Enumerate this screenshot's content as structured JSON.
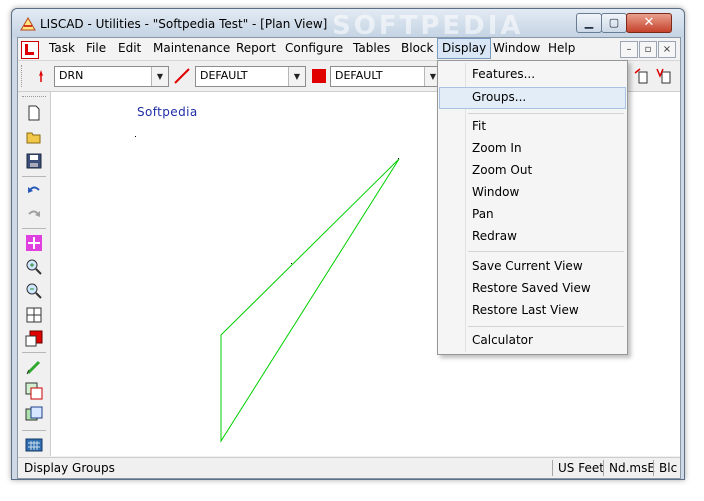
{
  "window": {
    "title": "LISCAD - Utilities - \"Softpedia Test\" - [Plan View]",
    "watermark": "SOFTPEDIA",
    "buttons": {
      "minimize": "▁",
      "maximize": "▢",
      "close": "✕"
    }
  },
  "menubar": {
    "items": [
      "Task",
      "File",
      "Edit",
      "Maintenance",
      "Report",
      "Configure",
      "Tables",
      "Block",
      "Display",
      "Window",
      "Help"
    ],
    "active": "Display",
    "mdi_buttons": [
      "–",
      "▫",
      "×"
    ]
  },
  "toolbar": {
    "layer_value": "DRN",
    "linetype_value": "DEFAULT",
    "color_value": "DEFAULT",
    "line_color": "#e00000",
    "fill_color": "#e00000"
  },
  "canvas": {
    "label": "Softpedia",
    "line_color": "#00d000"
  },
  "display_menu": {
    "items": [
      {
        "label": "Features...",
        "highlighted": false
      },
      {
        "label": "Groups...",
        "highlighted": true
      },
      {
        "label": "Fit",
        "highlighted": false
      },
      {
        "label": "Zoom In",
        "highlighted": false
      },
      {
        "label": "Zoom Out",
        "highlighted": false
      },
      {
        "label": "Window",
        "highlighted": false
      },
      {
        "label": "Pan",
        "highlighted": false
      },
      {
        "label": "Redraw",
        "highlighted": false
      },
      {
        "label": "Save Current View",
        "highlighted": false
      },
      {
        "label": "Restore Saved View",
        "highlighted": false
      },
      {
        "label": "Restore Last View",
        "highlighted": false
      },
      {
        "label": "Calculator",
        "highlighted": false
      }
    ]
  },
  "statusbar": {
    "message": "Display Groups",
    "units": "US Feet",
    "mode": "Nd.msE",
    "block": "Blc"
  },
  "icons": {
    "app": "liscad-app-icon",
    "left_toolbar": [
      "new-file-icon",
      "open-folder-icon",
      "save-disk-icon",
      "undo-icon",
      "redo-icon",
      "pan-icon",
      "zoom-in-icon",
      "zoom-out-icon",
      "zoom-window-icon",
      "layer-fill-icon",
      "pen-edit-icon",
      "group-icon",
      "display-icon",
      "calculator-icon"
    ]
  }
}
